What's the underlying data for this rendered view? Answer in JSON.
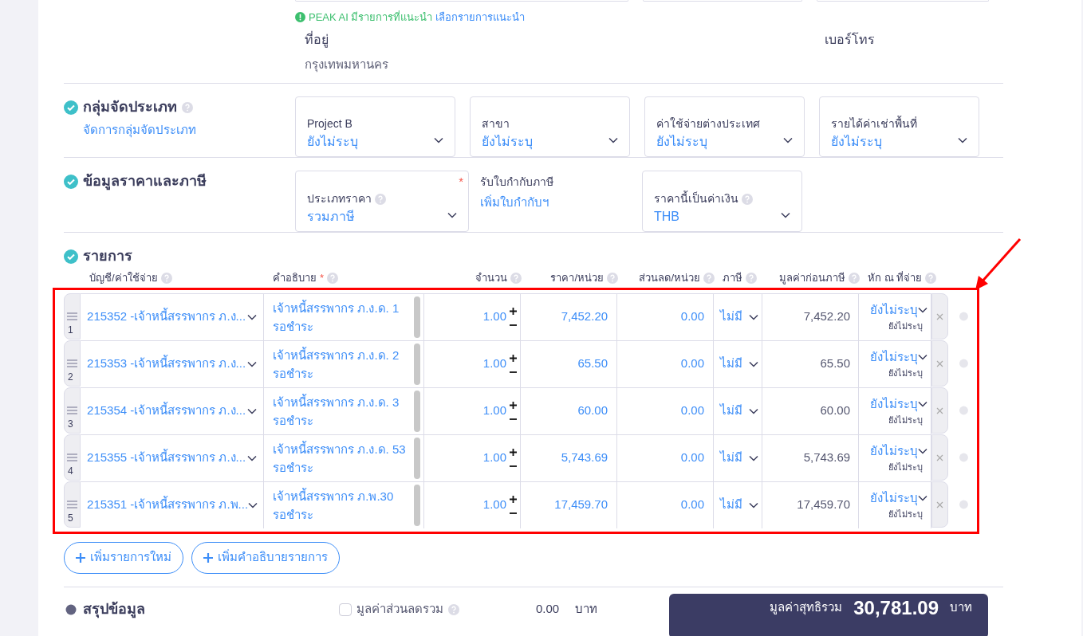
{
  "ai_hint": {
    "text": "PEAK AI มีรายการที่แนะนำ",
    "link": "เลือกรายการแนะนำ"
  },
  "contact": {
    "address_label": "ที่อยู่",
    "address": "กรุงเทพมหานคร",
    "phone_label": "เบอร์โทร"
  },
  "classification": {
    "title": "กลุ่มจัดประเภท",
    "link": "จัดการกลุ่มจัดประเภท",
    "done": true,
    "fields": [
      {
        "label": "Project B",
        "value": "ยังไม่ระบุ"
      },
      {
        "label": "สาขา",
        "value": "ยังไม่ระบุ"
      },
      {
        "label": "ค่าใช้จ่ายต่างประเทศ",
        "value": "ยังไม่ระบุ"
      },
      {
        "label": "รายได้ค่าเช่าพื้นที่",
        "value": "ยังไม่ระบุ"
      }
    ]
  },
  "pricing": {
    "title": "ข้อมูลราคาและภาษี",
    "done": true,
    "price_type": {
      "label": "ประเภทราคา",
      "value": "รวมภาษี",
      "mark": "*"
    },
    "tax_invoice": {
      "label": "รับใบกำกับภาษี",
      "link": "เพิ่มใบกำกับฯ"
    },
    "currency": {
      "label": "ราคานี้เป็นค่าเงิน",
      "value": "THB"
    }
  },
  "items": {
    "title": "รายการ",
    "done": true,
    "columns": [
      {
        "label": "บัญชี/ค่าใช้จ่าย"
      },
      {
        "label": "คำอธิบาย",
        "mark": "*"
      },
      {
        "label": "จำนวน"
      },
      {
        "label": "ราคา/หน่วย"
      },
      {
        "label": "ส่วนลด/หน่วย"
      },
      {
        "label": "ภาษี"
      },
      {
        "label": "มูลค่าก่อนภาษี"
      },
      {
        "label": "หัก ณ ที่จ่าย"
      }
    ],
    "rows": [
      {
        "index": "1",
        "account": "215352 -เจ้าหนี้สรรพากร ภ.ง...",
        "description": [
          "เจ้าหนี้สรรพากร ภ.ง.ด. 1",
          "รอชำระ"
        ],
        "quantity": "1.00",
        "price": "7,452.20",
        "discount": "0.00",
        "tax": "ไม่มี",
        "pretax": "7,452.20",
        "wht": "ยังไม่ระบุ",
        "wht_sub": "ยังไม่ระบุ"
      },
      {
        "index": "2",
        "account": "215353 -เจ้าหนี้สรรพากร ภ.ง...",
        "description": [
          "เจ้าหนี้สรรพากร ภ.ง.ด. 2",
          "รอชำระ"
        ],
        "quantity": "1.00",
        "price": "65.50",
        "discount": "0.00",
        "tax": "ไม่มี",
        "pretax": "65.50",
        "wht": "ยังไม่ระบุ",
        "wht_sub": "ยังไม่ระบุ"
      },
      {
        "index": "3",
        "account": "215354 -เจ้าหนี้สรรพากร ภ.ง...",
        "description": [
          "เจ้าหนี้สรรพากร ภ.ง.ด. 3",
          "รอชำระ"
        ],
        "quantity": "1.00",
        "price": "60.00",
        "discount": "0.00",
        "tax": "ไม่มี",
        "pretax": "60.00",
        "wht": "ยังไม่ระบุ",
        "wht_sub": "ยังไม่ระบุ"
      },
      {
        "index": "4",
        "account": "215355 -เจ้าหนี้สรรพากร ภ.ง...",
        "description": [
          "เจ้าหนี้สรรพากร ภ.ง.ด. 53",
          "รอชำระ"
        ],
        "quantity": "1.00",
        "price": "5,743.69",
        "discount": "0.00",
        "tax": "ไม่มี",
        "pretax": "5,743.69",
        "wht": "ยังไม่ระบุ",
        "wht_sub": "ยังไม่ระบุ"
      },
      {
        "index": "5",
        "account": "215351 -เจ้าหนี้สรรพากร ภ.พ...",
        "description": [
          "เจ้าหนี้สรรพากร ภ.พ.30",
          "รอชำระ"
        ],
        "quantity": "1.00",
        "price": "17,459.70",
        "discount": "0.00",
        "tax": "ไม่มี",
        "pretax": "17,459.70",
        "wht": "ยังไม่ระบุ",
        "wht_sub": "ยังไม่ระบุ"
      }
    ],
    "buttons": [
      "เพิ่มรายการใหม่",
      "เพิ่มคำอธิบายรายการ"
    ]
  },
  "summary": {
    "title": "สรุปข้อมูล",
    "done": false,
    "discount_total": {
      "label": "มูลค่าส่วนลดรวม",
      "checked": false,
      "value": "0.00",
      "unit": "บาท"
    },
    "net": {
      "label": "มูลค่าสุทธิรวม",
      "value": "30,781.09",
      "unit": "บาท"
    }
  }
}
